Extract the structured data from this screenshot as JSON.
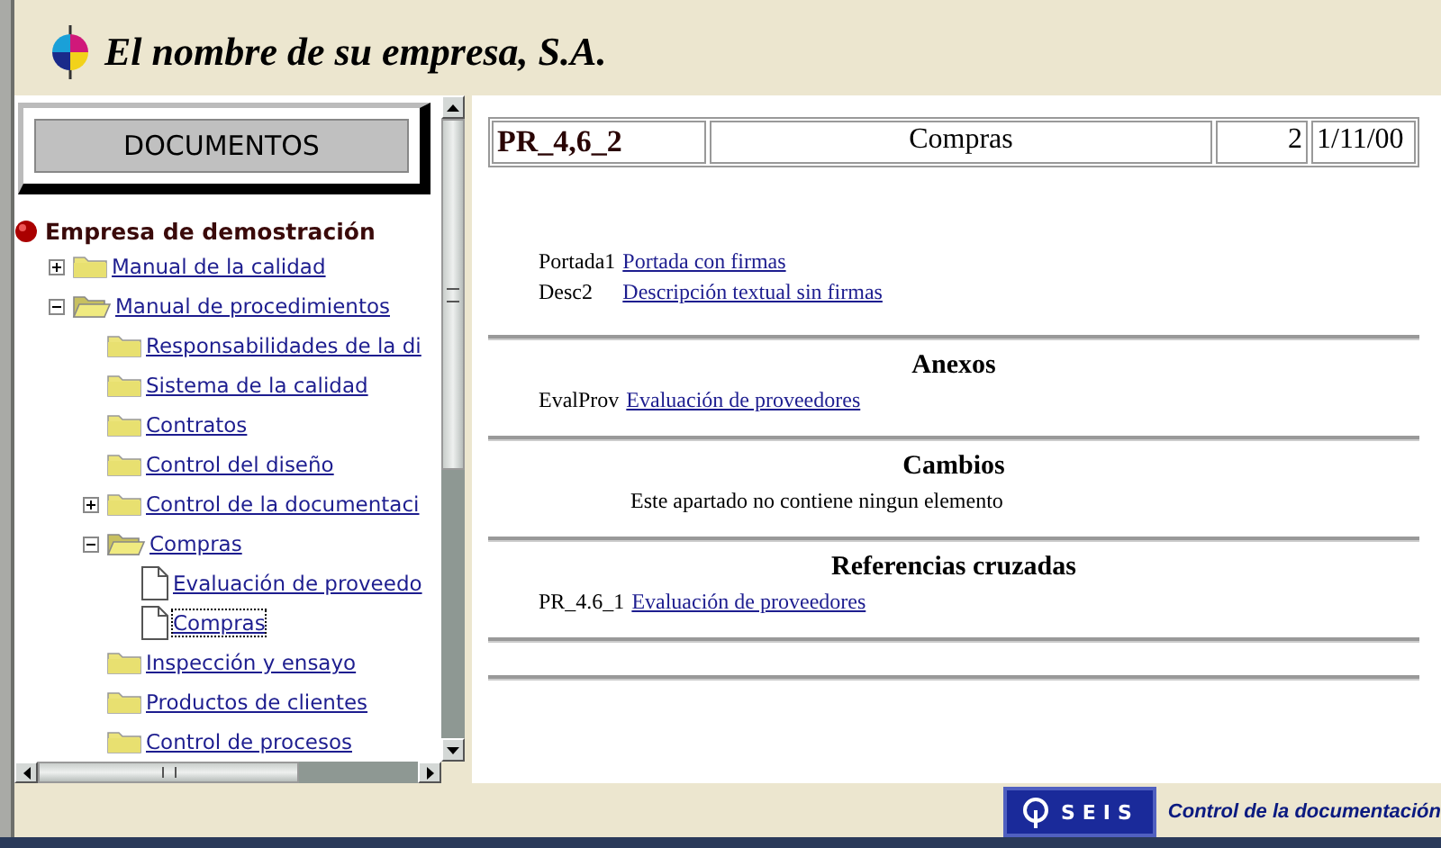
{
  "header": {
    "company": "El nombre de su empresa, S.A."
  },
  "sidebar": {
    "button": "DOCUMENTOS",
    "tree": {
      "label": "Empresa de demostración",
      "kind": "root",
      "selected": false,
      "children": [
        {
          "label": "Manual de la calidad",
          "kind": "folder",
          "expanded": false,
          "selected": false
        },
        {
          "label": "Manual de procedimientos",
          "kind": "folder",
          "expanded": true,
          "selected": false,
          "children": [
            {
              "label": "Responsabilidades de la di",
              "kind": "folder",
              "selected": false
            },
            {
              "label": "Sistema de la calidad",
              "kind": "folder",
              "selected": false
            },
            {
              "label": "Contratos",
              "kind": "folder",
              "selected": false
            },
            {
              "label": "Control del diseño",
              "kind": "folder",
              "selected": false
            },
            {
              "label": "Control de la documentaci",
              "kind": "folder",
              "expanded": false,
              "selected": false
            },
            {
              "label": "Compras",
              "kind": "folder",
              "expanded": true,
              "selected": false,
              "children": [
                {
                  "label": "Evaluación de proveedo",
                  "kind": "document",
                  "selected": false
                },
                {
                  "label": "Compras",
                  "kind": "document",
                  "selected": true
                }
              ]
            },
            {
              "label": "Inspección y ensayo",
              "kind": "folder",
              "selected": false
            },
            {
              "label": "Productos de clientes",
              "kind": "folder",
              "selected": false
            },
            {
              "label": "Control de procesos",
              "kind": "folder",
              "selected": false
            }
          ]
        }
      ]
    }
  },
  "document": {
    "header_cells": [
      "PR_4,6_2",
      "Compras",
      "2",
      "1/11/00"
    ],
    "sections": [
      {
        "entries": [
          {
            "code": "Portada1",
            "link": "Portada con firmas"
          },
          {
            "code": "Desc2",
            "link": "Descripción textual sin firmas"
          }
        ]
      },
      {
        "title": "Anexos",
        "entries": [
          {
            "code": "EvalProv",
            "link": "Evaluación de proveedores"
          }
        ]
      },
      {
        "title": "Cambios",
        "note": "Este apartado no contiene ningun elemento"
      },
      {
        "title": "Referencias cruzadas",
        "entries": [
          {
            "code": "PR_4.6_1",
            "link": "Evaluación de proveedores"
          }
        ]
      }
    ]
  },
  "footer": {
    "logo": "SEIS",
    "caption": "Control de la documentación"
  }
}
